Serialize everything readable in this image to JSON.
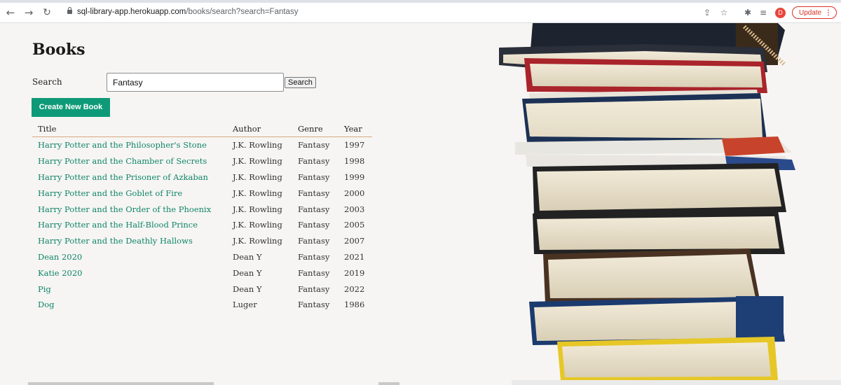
{
  "browser": {
    "url_host": "sql-library-app.herokuapp.com",
    "url_path": "/books/search?search=Fantasy",
    "profile_initial": "D",
    "update_label": "Update",
    "accent": "#d93025"
  },
  "icons": {
    "back": "arrow-left-icon",
    "forward": "arrow-right-icon",
    "reload": "reload-icon",
    "lock": "lock-icon",
    "share": "share-icon",
    "star": "star-icon",
    "extensions": "puzzle-icon",
    "reading_list": "reading-list-icon"
  },
  "page": {
    "title": "Books",
    "search_label": "Search",
    "search_value": "Fantasy",
    "search_button": "Search",
    "create_button": "Create New Book",
    "accent_color": "#0e9a78"
  },
  "table": {
    "headers": [
      "Title",
      "Author",
      "Genre",
      "Year"
    ],
    "rows": [
      [
        "Harry Potter and the Philosopher's Stone",
        "J.K. Rowling",
        "Fantasy",
        "1997"
      ],
      [
        "Harry Potter and the Chamber of Secrets",
        "J.K. Rowling",
        "Fantasy",
        "1998"
      ],
      [
        "Harry Potter and the Prisoner of Azkaban",
        "J.K. Rowling",
        "Fantasy",
        "1999"
      ],
      [
        "Harry Potter and the Goblet of Fire",
        "J.K. Rowling",
        "Fantasy",
        "2000"
      ],
      [
        "Harry Potter and the Order of the Phoenix",
        "J.K. Rowling",
        "Fantasy",
        "2003"
      ],
      [
        "Harry Potter and the Half-Blood Prince",
        "J.K. Rowling",
        "Fantasy",
        "2005"
      ],
      [
        "Harry Potter and the Deathly Hallows",
        "J.K. Rowling",
        "Fantasy",
        "2007"
      ],
      [
        "Dean 2020",
        "Dean Y",
        "Fantasy",
        "2021"
      ],
      [
        "Katie 2020",
        "Dean Y",
        "Fantasy",
        "2019"
      ],
      [
        "Pig",
        "Dean Y",
        "Fantasy",
        "2022"
      ],
      [
        "Dog",
        "Luger",
        "Fantasy",
        "1986"
      ]
    ]
  }
}
